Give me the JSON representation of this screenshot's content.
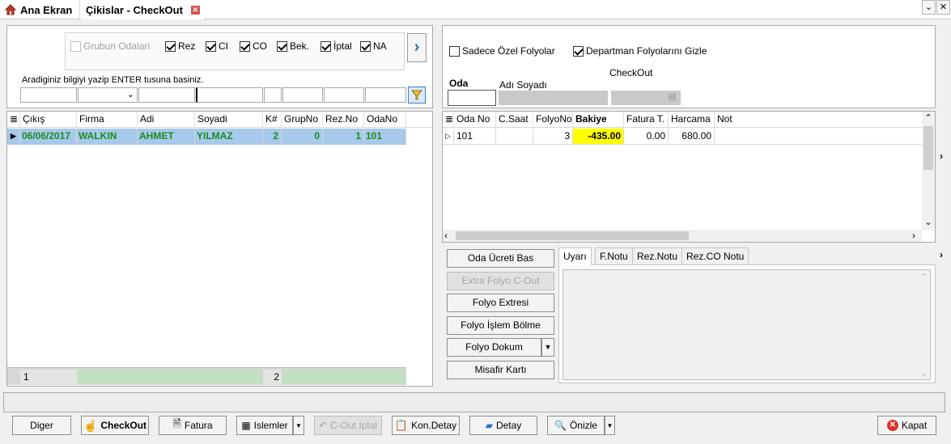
{
  "tabs": {
    "home": "Ana Ekran",
    "checkout": "Çikislar - CheckOut"
  },
  "filters": {
    "group_rooms": "Grubun Odalari",
    "statuses": [
      {
        "label": "Rez",
        "checked": true
      },
      {
        "label": "CI",
        "checked": true
      },
      {
        "label": "CO",
        "checked": true
      },
      {
        "label": "Bek.",
        "checked": true
      },
      {
        "label": "İptal",
        "checked": true
      },
      {
        "label": "NA",
        "checked": true
      }
    ],
    "search_hint": "Aradiginiz bilgiyi yazip ENTER tusuna basiniz."
  },
  "left_grid": {
    "columns": [
      "Çıkış",
      "Firma",
      "Adi",
      "Soyadi",
      "K#",
      "GrupNo",
      "Rez.No",
      "OdaNo"
    ],
    "rows": [
      {
        "cikis": "06/06/2017",
        "firma": "WALKIN",
        "adi": "AHMET",
        "soyadi": "YILMAZ",
        "k": "2",
        "grupno": "0",
        "rezno": "1",
        "odano": "101"
      }
    ],
    "footer": [
      "1",
      "2"
    ]
  },
  "right_top": {
    "only_special": "Sadece Özel Folyolar",
    "hide_department": "Departman Folyolarını Gizle",
    "checkout_label": "CheckOut",
    "room_label": "Oda",
    "name_label": "Adı Soyadı"
  },
  "folio_grid": {
    "columns": [
      "Oda No",
      "C.Saat",
      "FolyoNo",
      "Bakiye",
      "Fatura T.",
      "Harcama",
      "Not"
    ],
    "rows": [
      {
        "odano": "101",
        "csaat": "",
        "folyono": "3",
        "bakiye": "-435.00",
        "fatura": "0.00",
        "harcama": "680.00",
        "not": ""
      }
    ]
  },
  "action_buttons": [
    "Oda Ücreti Bas",
    "Extra Folyo C-Out",
    "Folyo Extresi",
    "Folyo İşlem Bölme",
    "Folyo Dokum",
    "Misafir Kartı"
  ],
  "note_tabs": [
    "Uyarı",
    "F.Notu",
    "Rez.Notu",
    "Rez.CO Notu"
  ],
  "bottom_bar": [
    "Diger",
    "CheckOut",
    "Fatura",
    "Islemler",
    "C-Out Iptal",
    "Kon.Detay",
    "Detay",
    "Önizle",
    "Kapat"
  ],
  "colors": {
    "selected_row": "#a6c9ec",
    "row_text": "#1e8c1e",
    "balance_bg": "#ffff00",
    "footer_green": "#c3e0c3"
  }
}
